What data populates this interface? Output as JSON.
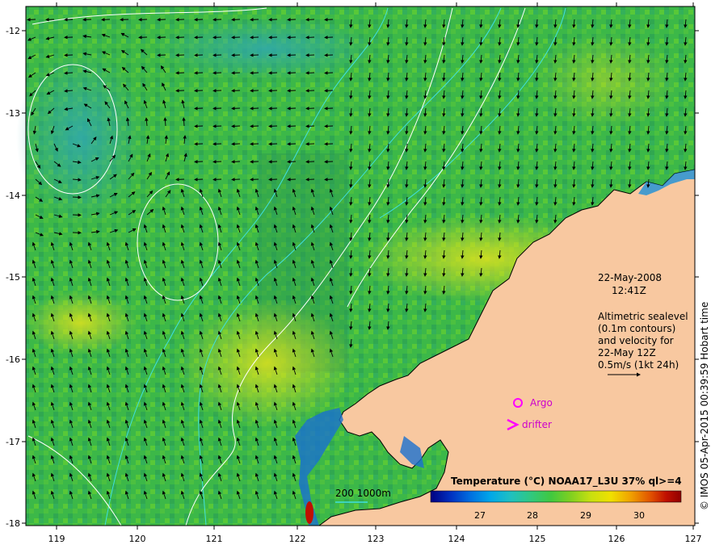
{
  "axes": {
    "x_ticks": [
      "119",
      "120",
      "121",
      "122",
      "123",
      "124",
      "125",
      "126",
      "127"
    ],
    "y_ticks": [
      "-12",
      "-13",
      "-14",
      "-15",
      "-16",
      "-17",
      "-18"
    ]
  },
  "timestamp": {
    "date": "22-May-2008",
    "time": "12:41Z"
  },
  "info": {
    "line1": "Altimetric sealevel",
    "line2": "(0.1m contours)",
    "line3": "and velocity for",
    "line4": "22-May 12Z",
    "line5": "0.5m/s (1kt 24h)"
  },
  "legend": {
    "argo": "Argo",
    "drifter": "drifter"
  },
  "depth_scale": {
    "label": "200  1000m"
  },
  "colorbar": {
    "title": "Temperature (°C) NOAA17_L3U 37% ql>=4",
    "ticks": [
      "27",
      "28",
      "29",
      "30"
    ],
    "colors": [
      "#000080",
      "#0030c0",
      "#0070e0",
      "#00a8e8",
      "#20c0c0",
      "#30c880",
      "#40c840",
      "#80d020",
      "#c8e010",
      "#f0e000",
      "#f0a000",
      "#e05000",
      "#c01000",
      "#900000"
    ]
  },
  "credit": "© IMOS 05-Apr-2015 00:39:59 Hobart time",
  "colors": {
    "ocean": "#3cb848",
    "land": "#f8c8a0",
    "contour": "#ffffff",
    "bathy": "#40e0e0",
    "marker": "#ff00ff"
  }
}
